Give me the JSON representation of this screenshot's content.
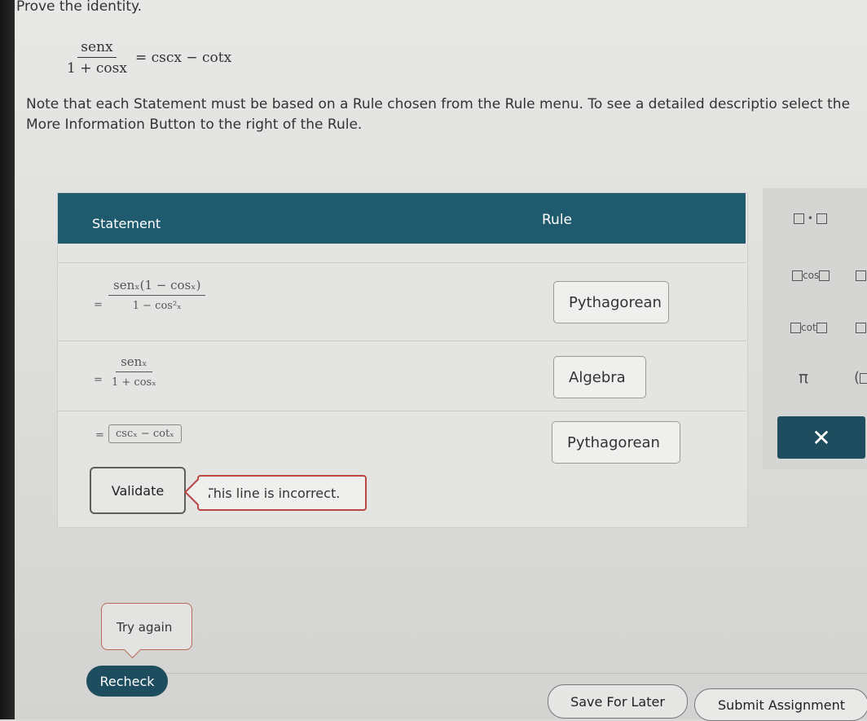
{
  "prompt": "Prove the identity.",
  "identity": {
    "numerator": "senx",
    "denominator": "1 + cosx",
    "rhs": "= cscx − cotx"
  },
  "note": "Note that each Statement must be based on a Rule chosen from the Rule menu. To see a detailed descriptio select the More Information Button to the right of the Rule.",
  "table": {
    "headers": {
      "statement": "Statement",
      "rule": "Rule"
    },
    "rows": [
      {
        "eq": "=",
        "num": "senₓ(1 − cosₓ)",
        "den": "1 − cos²ₓ",
        "rule": "Pythagorean"
      },
      {
        "eq": "=",
        "num": "senₓ",
        "den": "1 + cosₓ",
        "rule": "Algebra"
      },
      {
        "eq": "=",
        "expr": "cscₓ − cotₓ",
        "rule": "Pythagorean"
      }
    ]
  },
  "validate_label": "Validate",
  "error_message": "This line is incorrect.",
  "palette": {
    "dot": "□•□",
    "cos": "cos",
    "cot": "cot",
    "pi": "π",
    "paren": "(□",
    "close": "✕"
  },
  "try_again": "Try again",
  "buttons": {
    "recheck": "Recheck",
    "save": "Save For Later",
    "submit": "Submit Assignment"
  }
}
